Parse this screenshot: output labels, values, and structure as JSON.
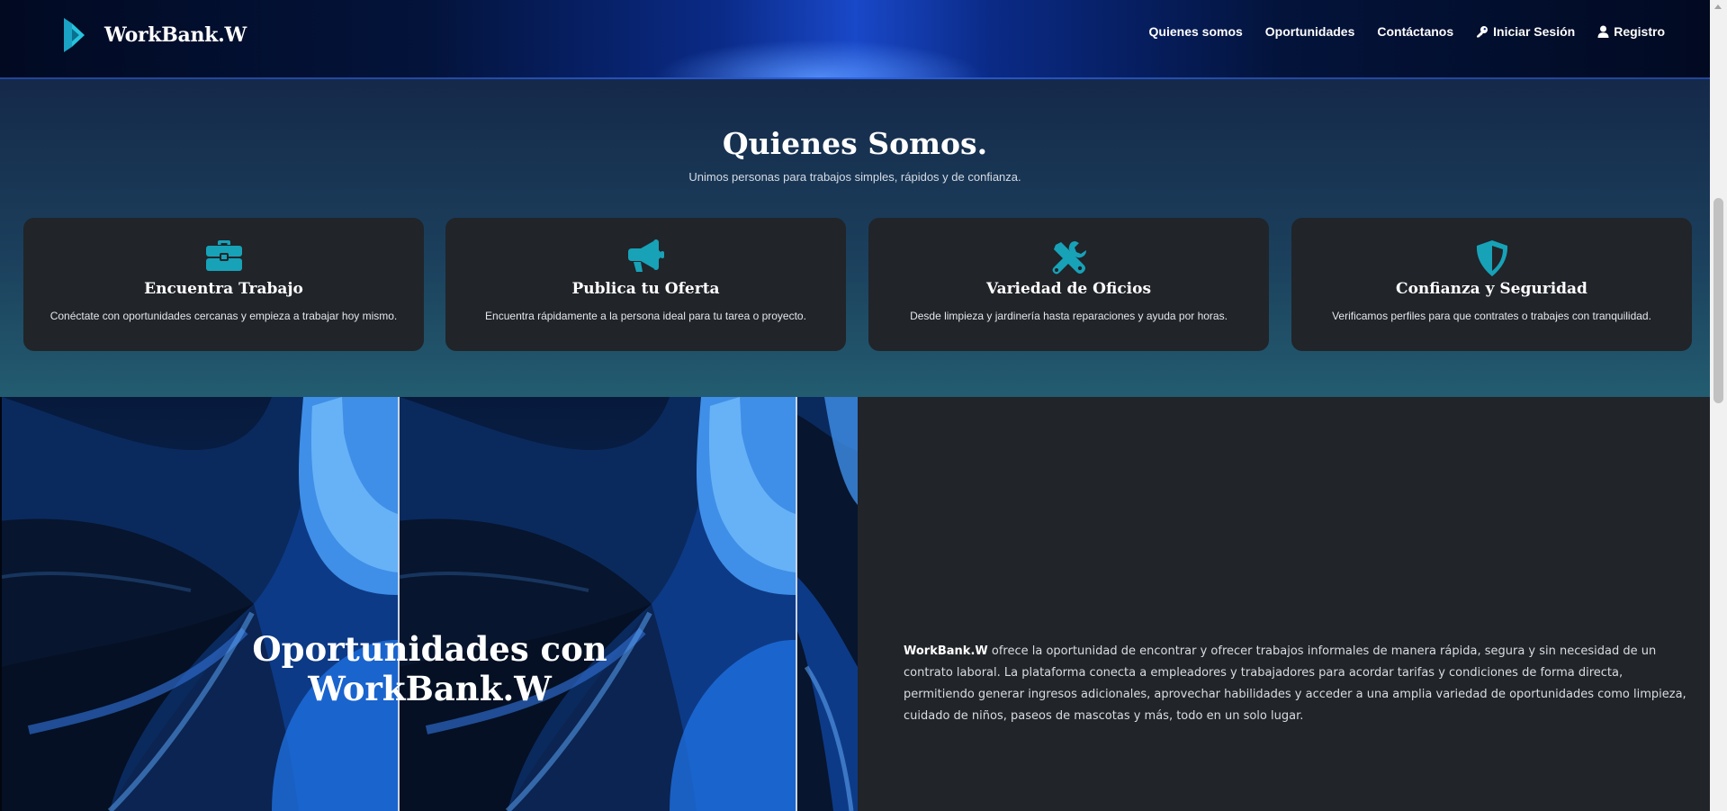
{
  "navbar": {
    "brand": "WorkBank.W",
    "links": [
      {
        "label": "Quienes somos"
      },
      {
        "label": "Oportunidades"
      },
      {
        "label": "Contáctanos"
      },
      {
        "label": "Iniciar Sesión",
        "icon": "key-icon"
      },
      {
        "label": "Registro",
        "icon": "user-icon"
      }
    ]
  },
  "about": {
    "title": "Quienes Somos.",
    "subtitle": "Unimos personas para trabajos simples, rápidos y de confianza.",
    "icon_color": "#17a2b8",
    "cards": [
      {
        "icon": "briefcase-icon",
        "title": "Encuentra Trabajo",
        "text": "Conéctate con oportunidades cercanas y empieza a trabajar hoy mismo."
      },
      {
        "icon": "megaphone-icon",
        "title": "Publica tu Oferta",
        "text": "Encuentra rápidamente a la persona ideal para tu tarea o proyecto."
      },
      {
        "icon": "tools-icon",
        "title": "Variedad de Oficios",
        "text": "Desde limpieza y jardinería hasta reparaciones y ayuda por horas."
      },
      {
        "icon": "shield-icon",
        "title": "Confianza y Seguridad",
        "text": "Verificamos perfiles para que contrates o trabajes con tranquilidad."
      }
    ]
  },
  "opportunities": {
    "title": "Oportunidades con WorkBank.W",
    "text_strong": "WorkBank.W",
    "text": " ofrece la oportunidad de encontrar y ofrecer trabajos informales de manera rápida, segura y sin necesidad de un contrato laboral. La plataforma conecta a empleadores y trabajadores para acordar tarifas y condiciones de forma directa, permitiendo generar ingresos adicionales, aprovechar habilidades y acceder a una amplia variedad de oportunidades como limpieza, cuidado de niños, paseos de mascotas y más, todo en un solo lugar."
  }
}
